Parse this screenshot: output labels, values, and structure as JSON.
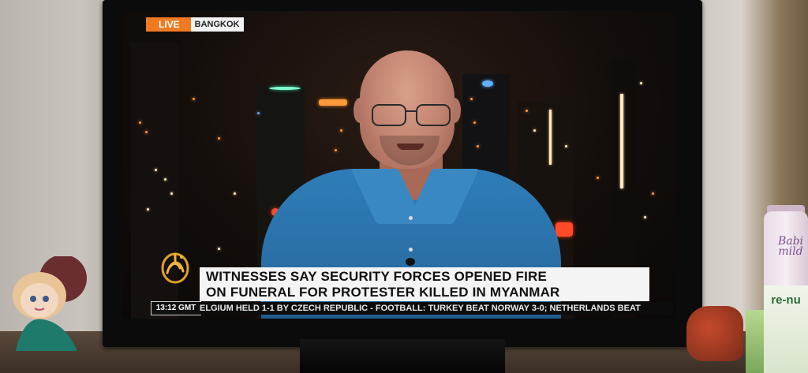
{
  "broadcast": {
    "live_label": "LIVE",
    "location": "BANGKOK",
    "headline_line1": "WITNESSES SAY SECURITY FORCES OPENED FIRE",
    "headline_line2": "ON FUNERAL FOR PROTESTER KILLED IN MYANMAR",
    "clock": "13:12 GMT",
    "ticker": "ELGIUM HELD 1-1 BY CZECH REPUBLIC  -  FOOTBALL: TURKEY BEAT NORWAY 3-0; NETHERLANDS BEAT",
    "live_color": "#f07a22",
    "logo_icon": "al-jazeera-logo"
  },
  "surroundings": {
    "bottle_label": "Babi mild",
    "box_label": "re-nu"
  }
}
